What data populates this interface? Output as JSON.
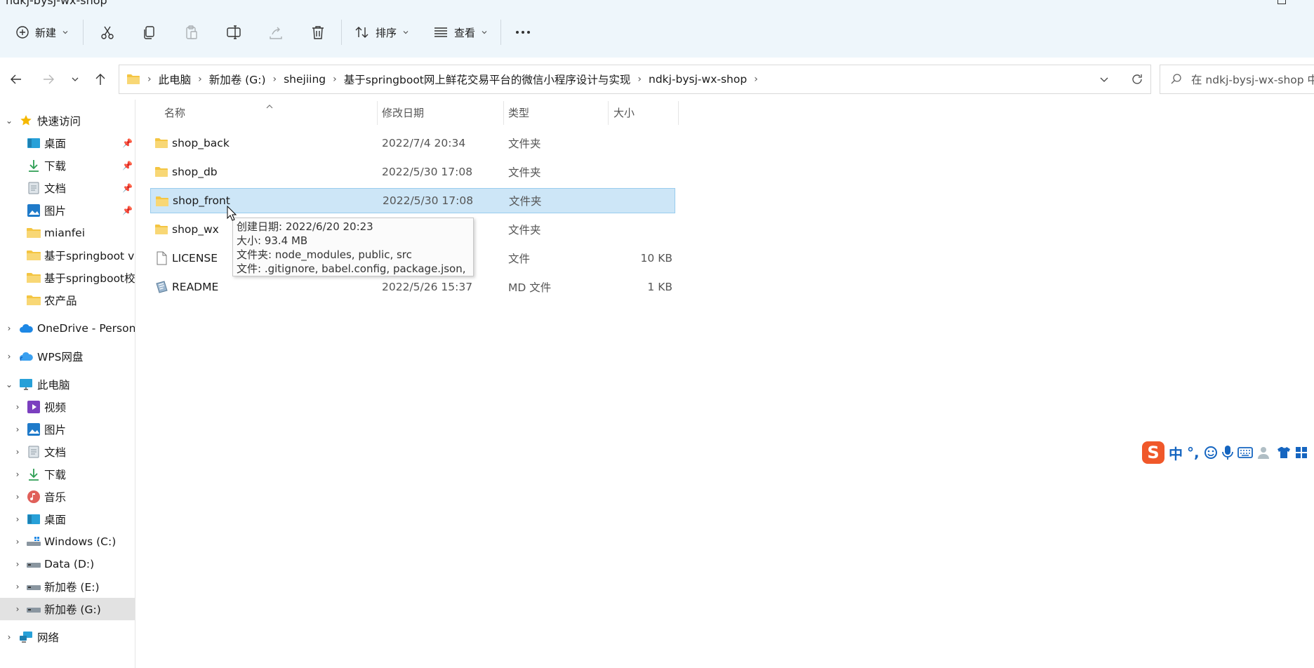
{
  "window": {
    "title": "ndkj-bysj-wx-shop"
  },
  "toolbar": {
    "new_label": "新建",
    "sort_label": "排序",
    "view_label": "查看"
  },
  "address": {
    "crumbs": [
      "此电脑",
      "新加卷 (G:)",
      "shejiing",
      "基于springboot网上鲜花交易平台的微信小程序设计与实现",
      "ndkj-bysj-wx-shop"
    ]
  },
  "search": {
    "placeholder": "在 ndkj-bysj-wx-shop 中"
  },
  "nav": {
    "quick_access": "快速访问",
    "quick_items": [
      "桌面",
      "下载",
      "文档",
      "图片",
      "mianfei",
      "基于springboot vu",
      "基于springboot校园",
      "农产品"
    ],
    "onedrive": "OneDrive - Persona",
    "wps": "WPS网盘",
    "this_pc": "此电脑",
    "pc_items": [
      "视频",
      "图片",
      "文档",
      "下载",
      "音乐",
      "桌面",
      "Windows (C:)",
      "Data (D:)",
      "新加卷 (E:)",
      "新加卷 (G:)"
    ],
    "network": "网络"
  },
  "columns": {
    "name": "名称",
    "date": "修改日期",
    "type": "类型",
    "size": "大小"
  },
  "files": [
    {
      "name": "shop_back",
      "date": "2022/7/4 20:34",
      "type": "文件夹",
      "size": "",
      "icon": "folder-icon"
    },
    {
      "name": "shop_db",
      "date": "2022/5/30 17:08",
      "type": "文件夹",
      "size": "",
      "icon": "folder-icon"
    },
    {
      "name": "shop_front",
      "date": "2022/5/30 17:08",
      "type": "文件夹",
      "size": "",
      "icon": "folder-icon",
      "selected": true
    },
    {
      "name": "shop_wx",
      "date": "",
      "type": "文件夹",
      "size": "",
      "icon": "folder-icon"
    },
    {
      "name": "LICENSE",
      "date": "",
      "type": "文件",
      "size": "10 KB",
      "icon": "file-icon"
    },
    {
      "name": "README",
      "date": "2022/5/26 15:37",
      "type": "MD 文件",
      "size": "1 KB",
      "icon": "md-file-icon"
    }
  ],
  "tooltip": {
    "created": "创建日期: 2022/6/20 20:23",
    "size": "大小: 93.4 MB",
    "folders": "文件夹: node_modules, public, src",
    "files": "文件: .gitignore, babel.config, package.json, ..."
  },
  "ime": {
    "mode": "中",
    "punct": "°,"
  },
  "colors": {
    "accent": "#0078d4",
    "selection": "#cde6f7",
    "folder": "#f4c542",
    "toolbar_bg": "#eef6fb"
  }
}
